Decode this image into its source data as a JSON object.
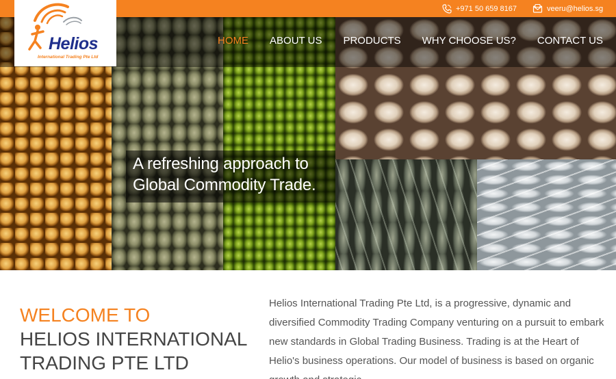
{
  "topbar": {
    "phone": "+971 50 659 8167",
    "email": "veeru@helios.sg",
    "accent": "#f58220"
  },
  "logo": {
    "name": "Helios",
    "tagline": "International Trading Pte Ltd"
  },
  "nav": {
    "items": [
      {
        "label": "HOME",
        "active": true
      },
      {
        "label": "ABOUT US"
      },
      {
        "label": "PRODUCTS"
      },
      {
        "label": "WHY CHOOSE US?"
      },
      {
        "label": "CONTACT US"
      }
    ]
  },
  "hero": {
    "caption_line1": "A refreshing approach to",
    "caption_line2": "Global Commodity Trade.",
    "slides": 3,
    "active_slide": 1
  },
  "welcome": {
    "line1": "WELCOME TO",
    "line2": "HELIOS INTERNATIONAL",
    "line3": "TRADING PTE LTD"
  },
  "intro": {
    "text": "Helios International Trading Pte Ltd, is a progressive, dynamic and diversified Commodity Trading Company venturing on a pursuit to embark new standards in Global Trading Business. Trading is at the Heart of Helio's business operations. Our model of business is based on organic growth and strategic"
  }
}
